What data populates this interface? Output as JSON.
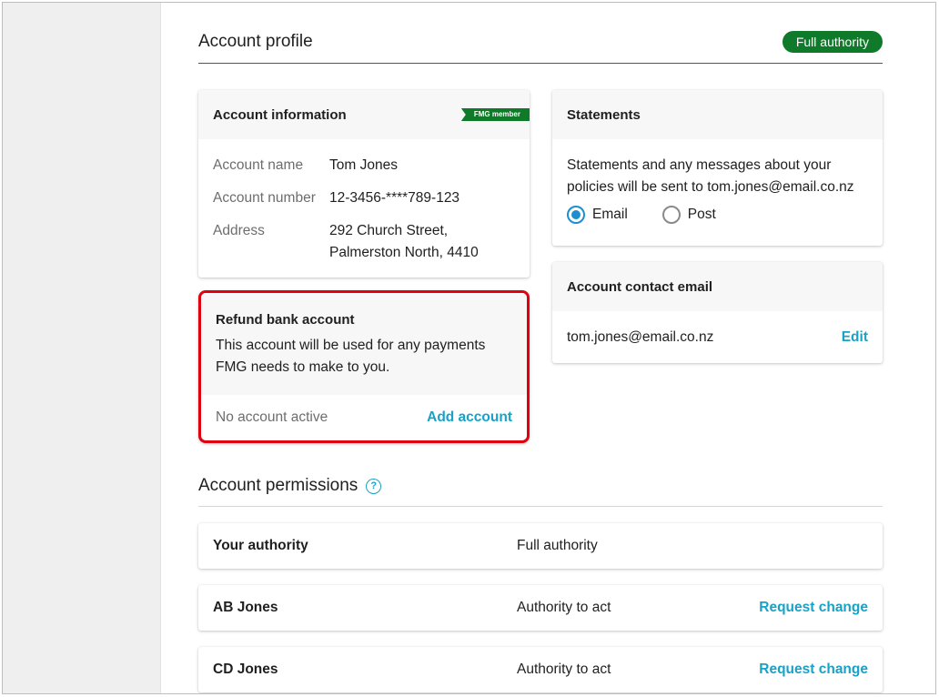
{
  "profile": {
    "title": "Account profile",
    "badge": "Full authority"
  },
  "account_info": {
    "title": "Account information",
    "tag": "FMG member",
    "rows": [
      {
        "label": "Account name",
        "value": "Tom Jones"
      },
      {
        "label": "Account number",
        "value": "12-3456-****789-123"
      },
      {
        "label": "Address",
        "value_line1": "292 Church Street,",
        "value_line2": "Palmerston North, 4410"
      }
    ]
  },
  "statements": {
    "title": "Statements",
    "description_line1": "Statements and any messages about your",
    "description_line2": "policies will be sent to tom.jones@email.co.nz",
    "options": [
      {
        "label": "Email",
        "selected": true
      },
      {
        "label": "Post",
        "selected": false
      }
    ]
  },
  "contact_email": {
    "title": "Account contact email",
    "email": "tom.jones@email.co.nz",
    "edit_label": "Edit"
  },
  "refund": {
    "title": "Refund bank account",
    "description_line1": "This account will be used for any payments",
    "description_line2": "FMG needs to make to you.",
    "status": "No account active",
    "add_label": "Add account",
    "highlight_color": "#e0000f"
  },
  "permissions": {
    "title": "Account permissions",
    "help_icon": "question-circle-icon",
    "rows": [
      {
        "name": "Your authority",
        "level": "Full authority",
        "action": ""
      },
      {
        "name": "AB Jones",
        "level": "Authority to act",
        "action": "Request change"
      },
      {
        "name": "CD Jones",
        "level": "Authority to act",
        "action": "Request change"
      }
    ]
  },
  "colors": {
    "brand_green": "#0e7a2a",
    "link_blue": "#17a2c7",
    "radio_blue": "#1e8fce"
  }
}
